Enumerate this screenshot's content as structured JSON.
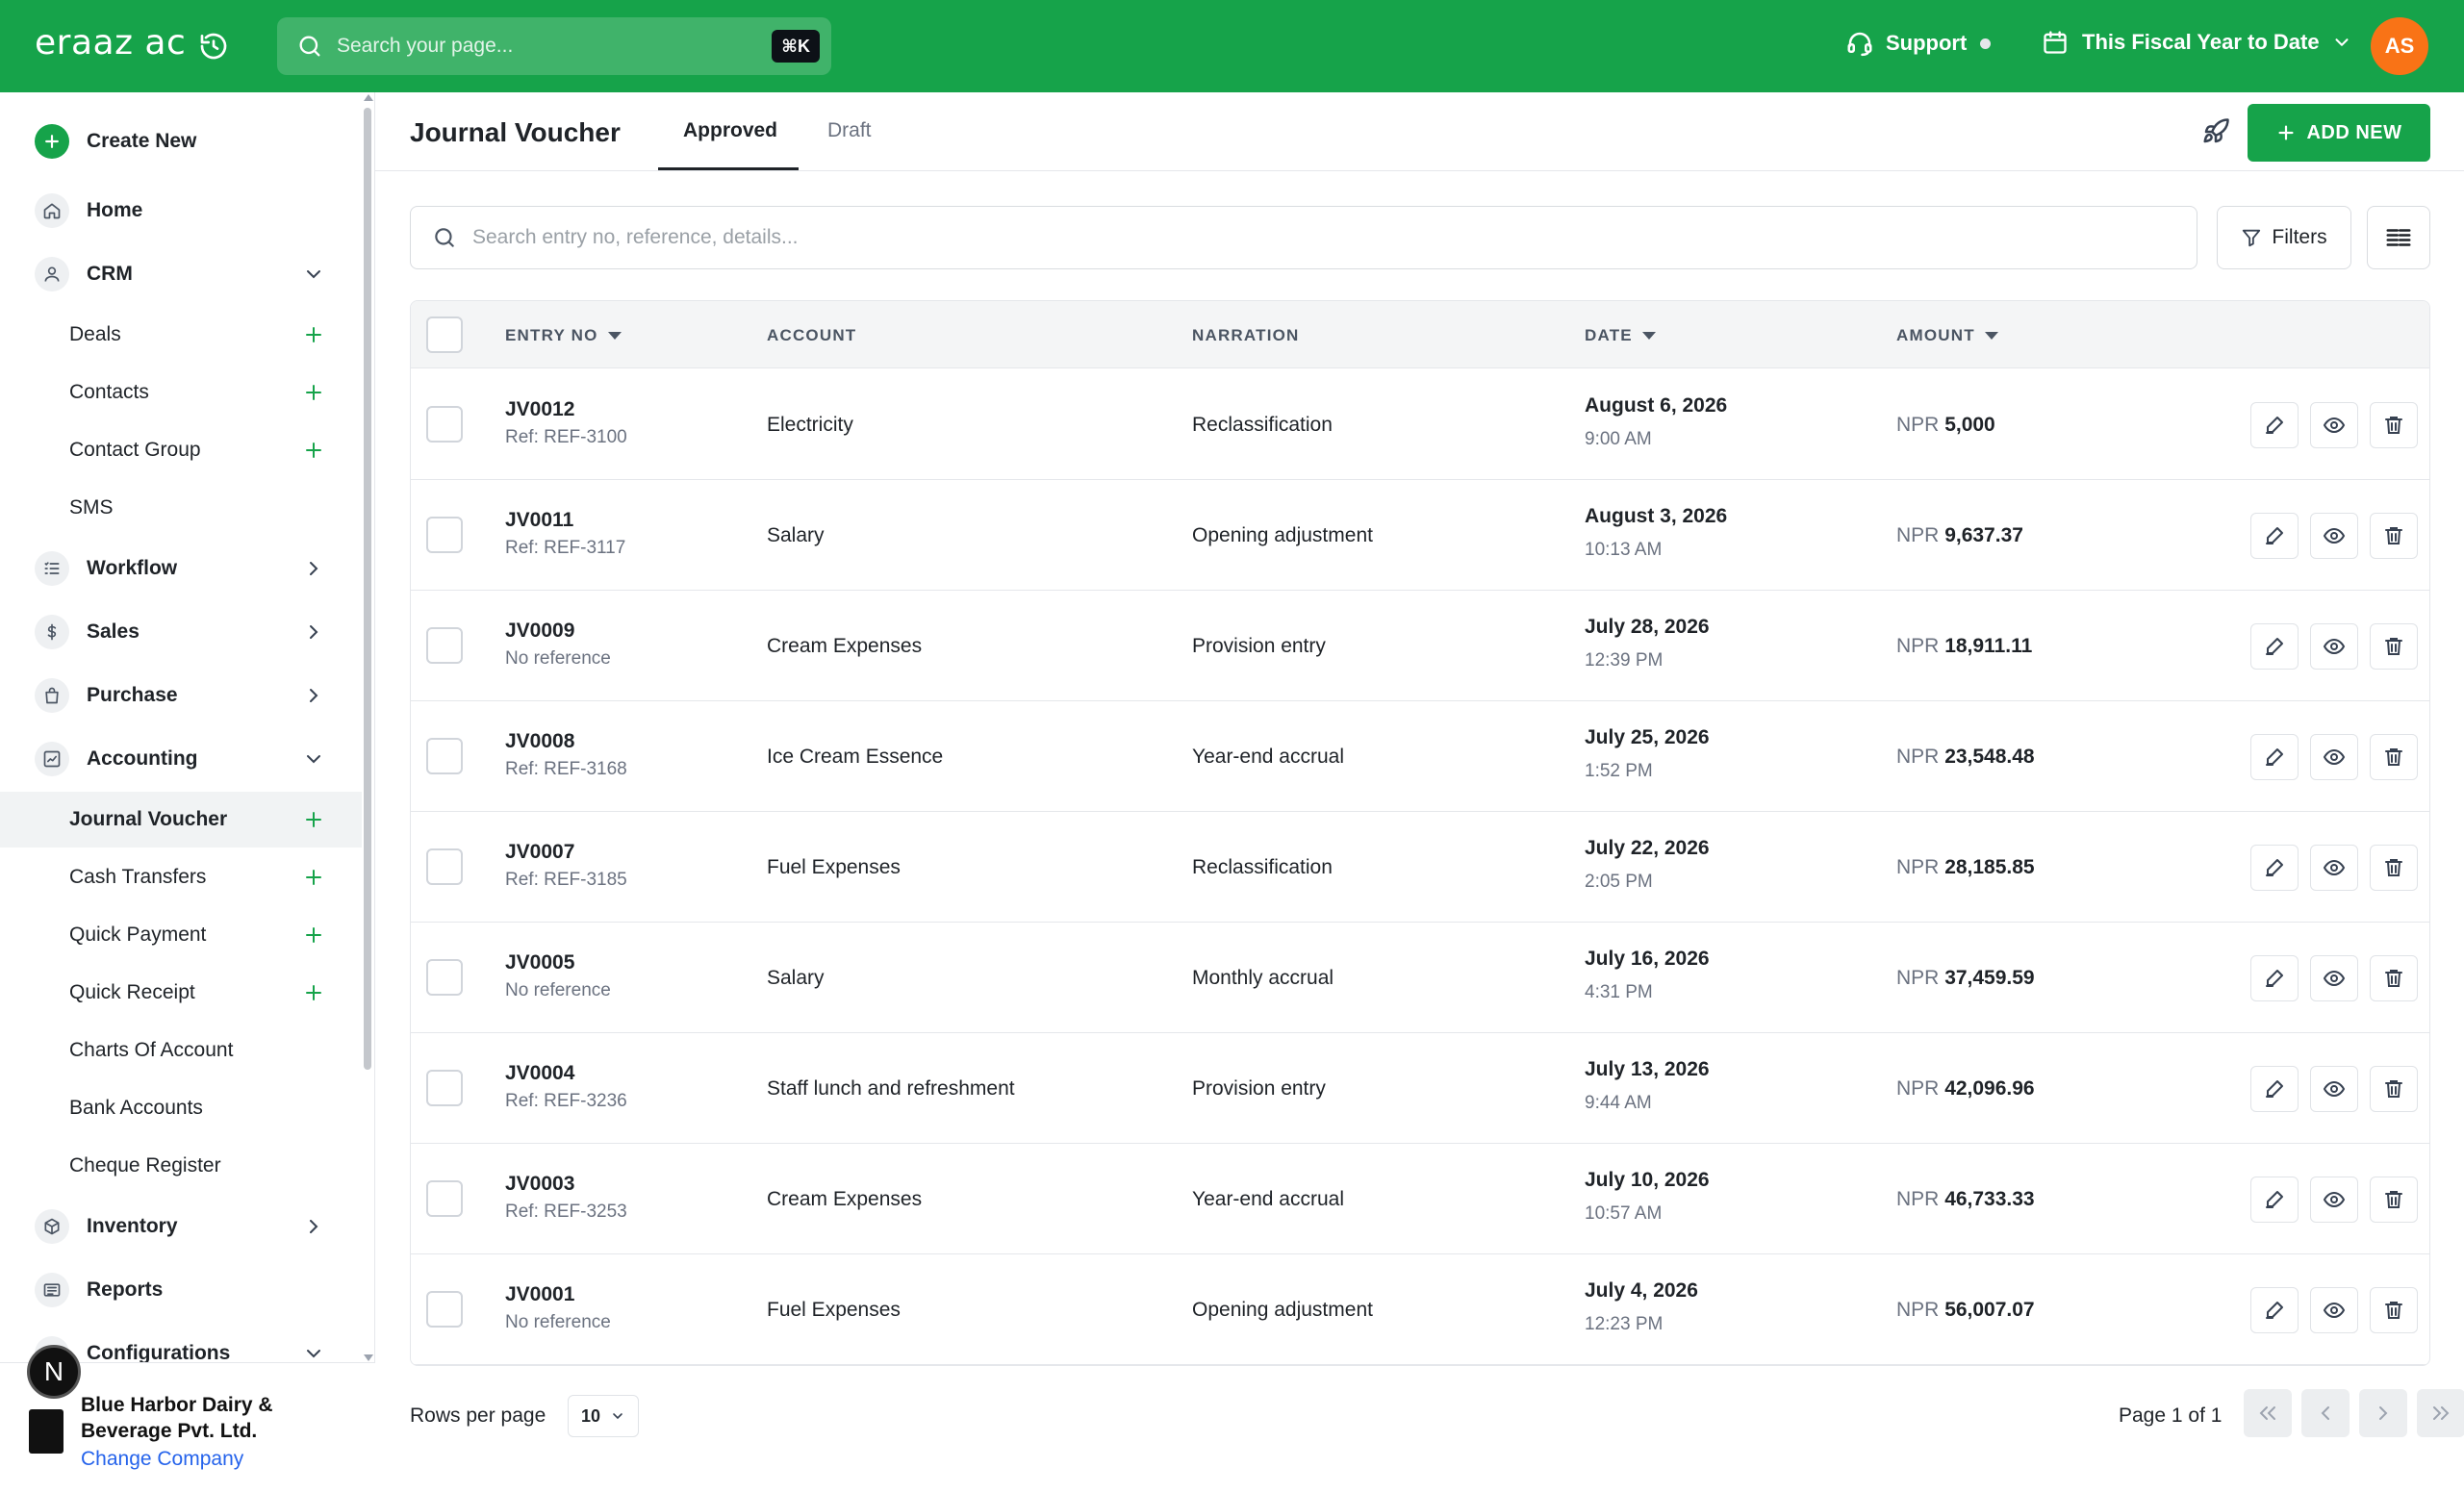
{
  "topbar": {
    "logo": "eraaz ac",
    "search_placeholder": "Search your page...",
    "shortcut": "⌘K",
    "support_label": "Support",
    "fiscal_label": "This Fiscal Year to Date",
    "avatar_initials": "AS",
    "brand_color": "#16a34a"
  },
  "sidebar": {
    "create_new": "Create New",
    "home": "Home",
    "crm": "CRM",
    "crm_items": [
      "Deals",
      "Contacts",
      "Contact Group",
      "SMS"
    ],
    "workflow": "Workflow",
    "sales": "Sales",
    "purchase": "Purchase",
    "accounting": "Accounting",
    "accounting_items": [
      "Journal Voucher",
      "Cash Transfers",
      "Quick Payment",
      "Quick Receipt",
      "Charts Of Account",
      "Bank Accounts",
      "Cheque Register"
    ],
    "inventory": "Inventory",
    "reports": "Reports",
    "configurations": "Configurations",
    "company_name": "Blue Harbor Dairy & Beverage Pvt. Ltd.",
    "change_company": "Change Company",
    "badge": "N"
  },
  "page": {
    "title": "Journal Voucher",
    "tabs": [
      "Approved",
      "Draft"
    ],
    "add_new": "ADD NEW",
    "search_placeholder": "Search entry no, reference, details...",
    "filters": "Filters"
  },
  "table": {
    "columns": [
      "ENTRY NO",
      "ACCOUNT",
      "NARRATION",
      "DATE",
      "AMOUNT"
    ],
    "currency": "NPR",
    "rows": [
      {
        "entry": "JV0012",
        "ref": "Ref: REF-3100",
        "account": "Electricity",
        "narration": "Reclassification",
        "date": "August 6, 2026",
        "time": "9:00 AM",
        "amount": "5,000"
      },
      {
        "entry": "JV0011",
        "ref": "Ref: REF-3117",
        "account": "Salary",
        "narration": "Opening adjustment",
        "date": "August 3, 2026",
        "time": "10:13 AM",
        "amount": "9,637.37"
      },
      {
        "entry": "JV0009",
        "ref": "No reference",
        "account": "Cream Expenses",
        "narration": "Provision entry",
        "date": "July 28, 2026",
        "time": "12:39 PM",
        "amount": "18,911.11"
      },
      {
        "entry": "JV0008",
        "ref": "Ref: REF-3168",
        "account": "Ice Cream Essence",
        "narration": "Year-end accrual",
        "date": "July 25, 2026",
        "time": "1:52 PM",
        "amount": "23,548.48"
      },
      {
        "entry": "JV0007",
        "ref": "Ref: REF-3185",
        "account": "Fuel Expenses",
        "narration": "Reclassification",
        "date": "July 22, 2026",
        "time": "2:05 PM",
        "amount": "28,185.85"
      },
      {
        "entry": "JV0005",
        "ref": "No reference",
        "account": "Salary",
        "narration": "Monthly accrual",
        "date": "July 16, 2026",
        "time": "4:31 PM",
        "amount": "37,459.59"
      },
      {
        "entry": "JV0004",
        "ref": "Ref: REF-3236",
        "account": "Staff lunch and refreshment",
        "narration": "Provision entry",
        "date": "July 13, 2026",
        "time": "9:44 AM",
        "amount": "42,096.96"
      },
      {
        "entry": "JV0003",
        "ref": "Ref: REF-3253",
        "account": "Cream Expenses",
        "narration": "Year-end accrual",
        "date": "July 10, 2026",
        "time": "10:57 AM",
        "amount": "46,733.33"
      },
      {
        "entry": "JV0001",
        "ref": "No reference",
        "account": "Fuel Expenses",
        "narration": "Opening adjustment",
        "date": "July 4, 2026",
        "time": "12:23 PM",
        "amount": "56,007.07"
      }
    ]
  },
  "pagination": {
    "rows_label": "Rows per page",
    "rows_value": "10",
    "page_info": "Page 1 of 1"
  }
}
